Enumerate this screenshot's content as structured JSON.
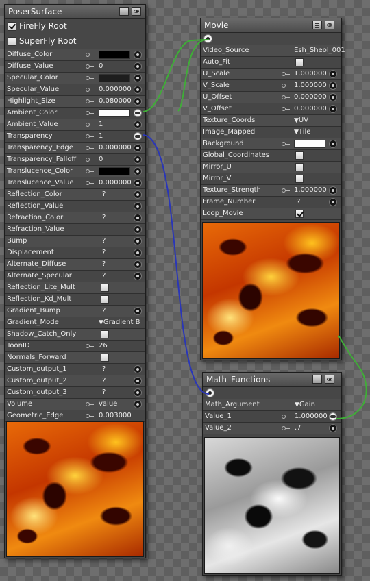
{
  "colors": {
    "wire_green": "#3fae37",
    "wire_blue": "#2a36b8",
    "swatch_black": "#000000",
    "swatch_dark": "#1e1e1e",
    "swatch_white": "#ffffff"
  },
  "poser_surface": {
    "title": "PoserSurface",
    "roots": [
      {
        "label": "FireFly Root",
        "checked": true
      },
      {
        "label": "SuperFly Root",
        "checked": false
      }
    ],
    "params": [
      {
        "label": "Diffuse_Color",
        "type": "swatch",
        "color": "#000000",
        "key": true,
        "linked": false
      },
      {
        "label": "Diffuse_Value",
        "type": "value",
        "value": "0",
        "key": true,
        "linked": false
      },
      {
        "label": "Specular_Color",
        "type": "swatch",
        "color": "#1e1e1e",
        "key": true,
        "linked": false
      },
      {
        "label": "Specular_Value",
        "type": "value",
        "value": "0.000000",
        "key": true,
        "linked": false
      },
      {
        "label": "Highlight_Size",
        "type": "value",
        "value": "0.080000",
        "key": true,
        "linked": false
      },
      {
        "label": "Ambient_Color",
        "type": "swatch",
        "color": "#ffffff",
        "key": true,
        "linked": true
      },
      {
        "label": "Ambient_Value",
        "type": "value",
        "value": "1",
        "key": true,
        "linked": false
      },
      {
        "label": "Transparency",
        "type": "value",
        "value": "1",
        "key": true,
        "linked": true
      },
      {
        "label": "Transparency_Edge",
        "type": "value",
        "value": "0.000000",
        "key": true,
        "linked": false
      },
      {
        "label": "Transparency_Falloff",
        "type": "value",
        "value": "0",
        "key": true,
        "linked": false
      },
      {
        "label": "Translucence_Color",
        "type": "swatch",
        "color": "#000000",
        "key": true,
        "linked": false
      },
      {
        "label": "Translucence_Value",
        "type": "value",
        "value": "0.000000",
        "key": true,
        "linked": false
      },
      {
        "label": "Reflection_Color",
        "type": "q",
        "value": "?",
        "linked": false
      },
      {
        "label": "Reflection_Value",
        "type": "none",
        "linked": false
      },
      {
        "label": "Refraction_Color",
        "type": "q",
        "value": "?",
        "linked": false
      },
      {
        "label": "Refraction_Value",
        "type": "none",
        "linked": false
      },
      {
        "label": "Bump",
        "type": "q",
        "value": "?",
        "linked": false
      },
      {
        "label": "Displacement",
        "type": "q",
        "value": "?",
        "linked": false
      },
      {
        "label": "Alternate_Diffuse",
        "type": "q",
        "value": "?",
        "linked": false
      },
      {
        "label": "Alternate_Specular",
        "type": "q",
        "value": "?",
        "linked": false
      },
      {
        "label": "Reflection_Lite_Mult",
        "type": "check",
        "checked": false,
        "noport": true
      },
      {
        "label": "Reflection_Kd_Mult",
        "type": "check",
        "checked": false,
        "noport": true
      },
      {
        "label": "Gradient_Bump",
        "type": "q",
        "value": "?",
        "linked": false
      },
      {
        "label": "Gradient_Mode",
        "type": "dropdown",
        "value": "Gradient B",
        "noport": true
      },
      {
        "label": "Shadow_Catch_Only",
        "type": "check",
        "checked": false,
        "noport": true
      },
      {
        "label": "ToonID",
        "type": "value",
        "value": "26",
        "key": true,
        "noport": true
      },
      {
        "label": "Normals_Forward",
        "type": "check",
        "checked": false,
        "noport": true
      },
      {
        "label": "Custom_output_1",
        "type": "q",
        "value": "?",
        "linked": false
      },
      {
        "label": "Custom_output_2",
        "type": "q",
        "value": "?",
        "linked": false
      },
      {
        "label": "Custom_output_3",
        "type": "q",
        "value": "?",
        "linked": false
      },
      {
        "label": "Volume",
        "type": "value",
        "value": "value",
        "key": true,
        "linked": false
      },
      {
        "label": "Geometric_Edge",
        "type": "value",
        "value": "0.003000",
        "key": true,
        "noport": true
      }
    ]
  },
  "movie": {
    "title": "Movie",
    "params": [
      {
        "label": "Video_Source",
        "type": "text",
        "value": "Esh_Sheol_001",
        "noport": true
      },
      {
        "label": "Auto_Fit",
        "type": "check",
        "checked": false,
        "noport": true
      },
      {
        "label": "U_Scale",
        "type": "value",
        "value": "1.000000",
        "key": true,
        "linked": false
      },
      {
        "label": "V_Scale",
        "type": "value",
        "value": "1.000000",
        "key": true,
        "linked": false
      },
      {
        "label": "U_Offset",
        "type": "value",
        "value": "0.000000",
        "key": true,
        "linked": false
      },
      {
        "label": "V_Offset",
        "type": "value",
        "value": "0.000000",
        "key": true,
        "linked": false
      },
      {
        "label": "Texture_Coords",
        "type": "dropdown",
        "value": "UV",
        "noport": true
      },
      {
        "label": "Image_Mapped",
        "type": "dropdown",
        "value": "Tile",
        "noport": true
      },
      {
        "label": "Background",
        "type": "swatch",
        "color": "#ffffff",
        "key": true,
        "linked": false
      },
      {
        "label": "Global_Coordinates",
        "type": "check",
        "checked": false,
        "noport": true
      },
      {
        "label": "Mirror_U",
        "type": "check",
        "checked": false,
        "noport": true
      },
      {
        "label": "Mirror_V",
        "type": "check",
        "checked": false,
        "noport": true
      },
      {
        "label": "Texture_Strength",
        "type": "value",
        "value": "1.000000",
        "key": true,
        "linked": false
      },
      {
        "label": "Frame_Number",
        "type": "q",
        "value": "?",
        "linked": false
      },
      {
        "label": "Loop_Movie",
        "type": "check",
        "checked": true,
        "noport": true
      }
    ]
  },
  "math_functions": {
    "title": "Math_Functions",
    "params": [
      {
        "label": "Math_Argument",
        "type": "dropdown",
        "value": "Gain",
        "noport": true
      },
      {
        "label": "Value_1",
        "type": "value",
        "value": "1.000000",
        "key": true,
        "linked": true
      },
      {
        "label": "Value_2",
        "type": "value",
        "value": ".7",
        "key": true,
        "linked": false
      }
    ]
  }
}
